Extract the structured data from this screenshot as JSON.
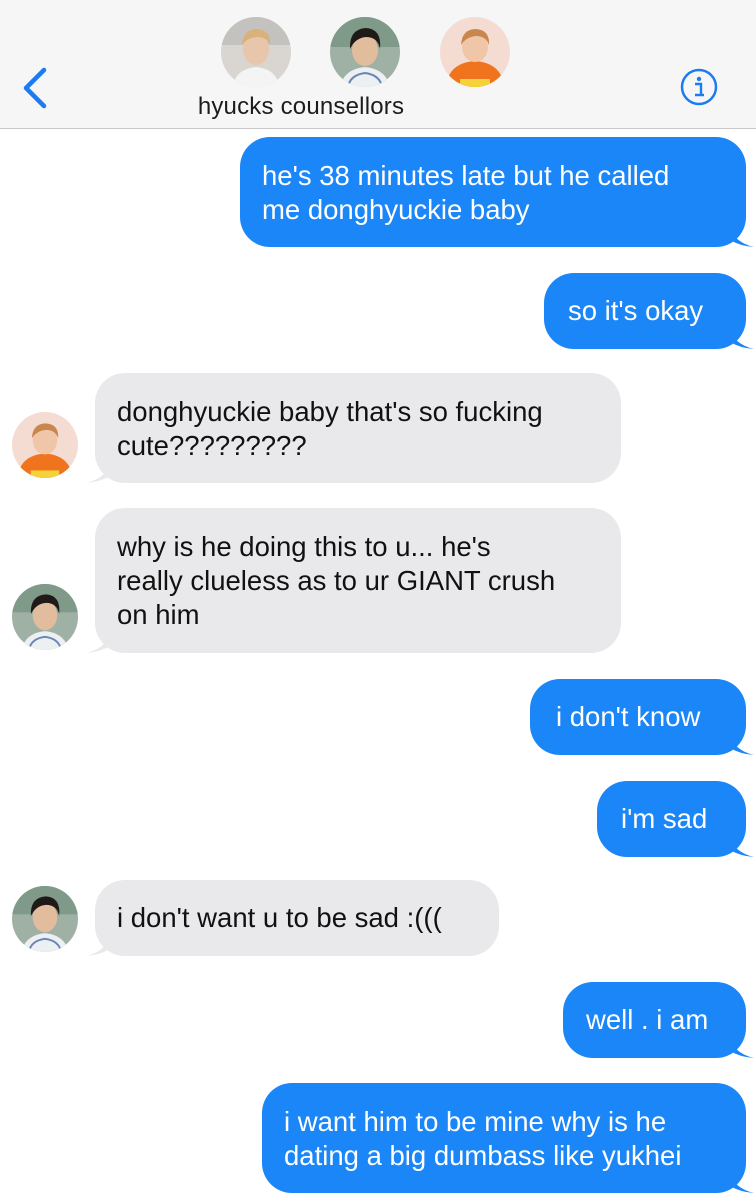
{
  "header": {
    "group_name": "hyucks counsellors",
    "back_icon": "chevron-left-icon",
    "info_icon": "info-icon",
    "accent": "#1b7cf2"
  },
  "colors": {
    "outgoing_bubble": "#1b86f8",
    "incoming_bubble": "#e9e9eb"
  },
  "messages": [
    {
      "side": "out",
      "text": "he's 38 minutes late but he called\nme donghyuckie baby"
    },
    {
      "side": "out",
      "text": "so it's okay"
    },
    {
      "side": "in",
      "sender_avatar": "orange-hoodie",
      "text": "donghyuckie baby that's so fucking\ncute?????????"
    },
    {
      "side": "in",
      "sender_avatar": "dark-hair",
      "text": "why is he doing this to u... he's\nreally clueless as to ur GIANT crush\non him"
    },
    {
      "side": "out",
      "text": "i don't know"
    },
    {
      "side": "out",
      "text": "i'm sad"
    },
    {
      "side": "in",
      "sender_avatar": "dark-hair",
      "text": "i don't want u to be sad :((("
    },
    {
      "side": "out",
      "text": "well . i am"
    },
    {
      "side": "out",
      "text": "i want him to be mine why is he\ndating a big dumbass like yukhei"
    }
  ]
}
